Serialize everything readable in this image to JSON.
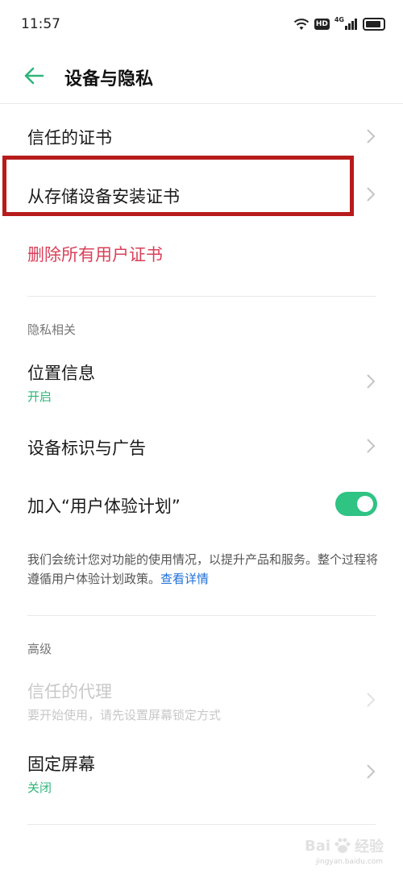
{
  "status_bar": {
    "time": "11:57",
    "hd_badge": "HD",
    "network_label": "4G"
  },
  "header": {
    "title": "设备与隐私"
  },
  "certificates": {
    "trusted": "信任的证书",
    "install_from_storage": "从存储设备安装证书",
    "delete_all_user": "删除所有用户证书"
  },
  "privacy": {
    "section_title": "隐私相关",
    "location_label": "位置信息",
    "location_status": "开启",
    "device_id_ads": "设备标识与广告",
    "ux_plan_label": "加入“用户体验计划”",
    "ux_plan_enabled": true,
    "description": "我们会统计您对功能的使用情况，以提升产品和服务。整个过程将遵循用户体验计划政策。",
    "details_link": "查看详情"
  },
  "advanced": {
    "section_title": "高级",
    "trust_agents_label": "信任的代理",
    "trust_agents_sub": "要开始使用，请先设置屏幕锁定方式",
    "screen_pinning_label": "固定屏幕",
    "screen_pinning_status": "关闭"
  },
  "watermark": {
    "brand": "Bai",
    "brand_suffix": "经验",
    "domain": "jingyan.baidu.com"
  },
  "colors": {
    "accent_green": "#2fc384",
    "danger_red": "#d9415a",
    "link_blue": "#1e6fd9",
    "highlight_box": "#b71b1b"
  }
}
